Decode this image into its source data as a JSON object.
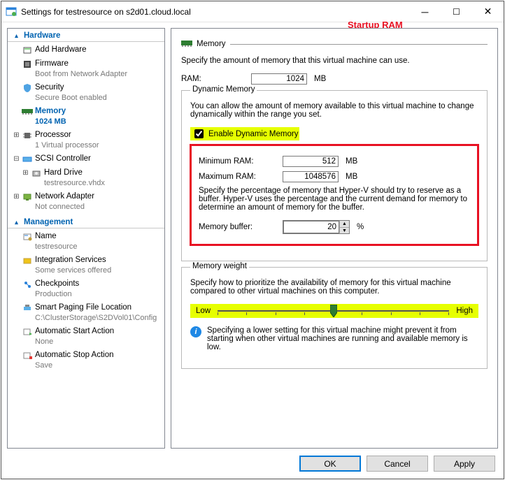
{
  "window": {
    "title": "Settings for testresource on s2d01.cloud.local"
  },
  "annotation": {
    "startup_ram": "Startup RAM"
  },
  "sidebar": {
    "hardware_label": "Hardware",
    "management_label": "Management",
    "items": [
      {
        "label": "Add Hardware",
        "sub": ""
      },
      {
        "label": "Firmware",
        "sub": "Boot from Network Adapter"
      },
      {
        "label": "Security",
        "sub": "Secure Boot enabled"
      },
      {
        "label": "Memory",
        "sub": "1024 MB"
      },
      {
        "label": "Processor",
        "sub": "1 Virtual processor"
      },
      {
        "label": "SCSI Controller",
        "sub": ""
      },
      {
        "label": "Hard Drive",
        "sub": "testresource.vhdx"
      },
      {
        "label": "Network Adapter",
        "sub": "Not connected"
      }
    ],
    "mgmt": [
      {
        "label": "Name",
        "sub": "testresource"
      },
      {
        "label": "Integration Services",
        "sub": "Some services offered"
      },
      {
        "label": "Checkpoints",
        "sub": "Production"
      },
      {
        "label": "Smart Paging File Location",
        "sub": "C:\\ClusterStorage\\S2DVol01\\Config"
      },
      {
        "label": "Automatic Start Action",
        "sub": "None"
      },
      {
        "label": "Automatic Stop Action",
        "sub": "Save"
      }
    ]
  },
  "main": {
    "section_title": "Memory",
    "intro": "Specify the amount of memory that this virtual machine can use.",
    "ram_label": "RAM:",
    "ram_value": "1024",
    "ram_unit": "MB",
    "dynamic": {
      "group": "Dynamic Memory",
      "desc": "You can allow the amount of memory available to this virtual machine to change dynamically within the range you set.",
      "enable_label": "Enable Dynamic Memory",
      "min_label": "Minimum RAM:",
      "min_value": "512",
      "max_label": "Maximum RAM:",
      "max_value": "1048576",
      "unit": "MB",
      "buffer_desc": "Specify the percentage of memory that Hyper-V should try to reserve as a buffer. Hyper-V uses the percentage and the current demand for memory to determine an amount of memory for the buffer.",
      "buffer_label": "Memory buffer:",
      "buffer_value": "20",
      "buffer_unit": "%"
    },
    "weight": {
      "group": "Memory weight",
      "desc": "Specify how to prioritize the availability of memory for this virtual machine compared to other virtual machines on this computer.",
      "low": "Low",
      "high": "High",
      "info": "Specifying a lower setting for this virtual machine might prevent it from starting when other virtual machines are running and available memory is low."
    }
  },
  "buttons": {
    "ok": "OK",
    "cancel": "Cancel",
    "apply": "Apply"
  }
}
